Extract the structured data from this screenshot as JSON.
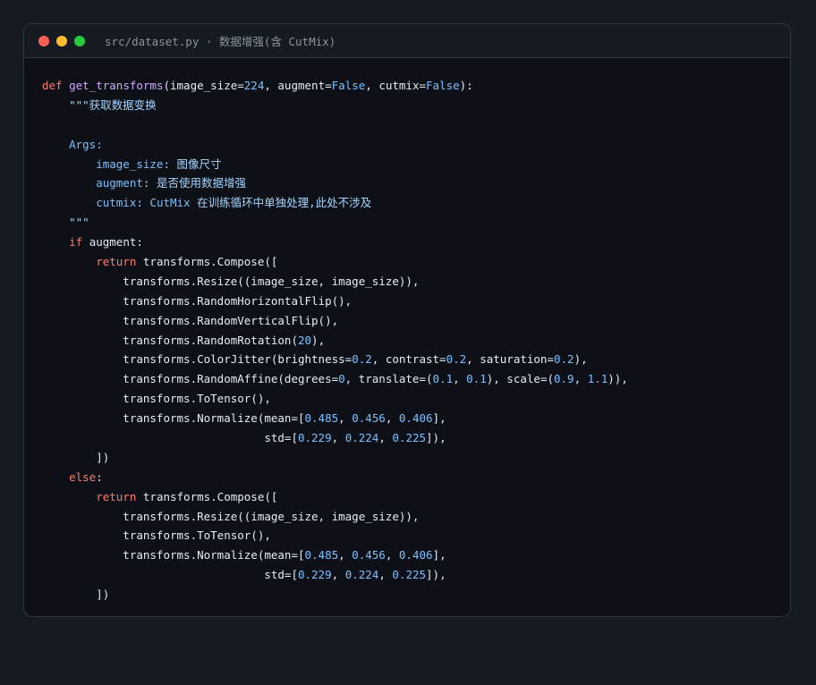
{
  "window": {
    "title": "src/dataset.py · 数据增强(含 CutMix)",
    "traffic_lights": [
      {
        "name": "close",
        "color": "#ff5f56"
      },
      {
        "name": "minimize",
        "color": "#ffbd2e"
      },
      {
        "name": "maximize",
        "color": "#27c93f"
      }
    ]
  },
  "colors": {
    "background": "#161b22",
    "editor": "#0d1117",
    "keyword": "#ff7b72",
    "function": "#d2a8ff",
    "number": "#79c0ff",
    "docstring": "#a5d6ff",
    "text": "#e6edf3"
  },
  "code_lines": [
    [
      [
        "kw",
        "def "
      ],
      [
        "fn",
        "get_transforms"
      ],
      [
        "p",
        "(image_size="
      ],
      [
        "num",
        "224"
      ],
      [
        "p",
        ", augment="
      ],
      [
        "cn",
        "False"
      ],
      [
        "p",
        ", cutmix="
      ],
      [
        "cn",
        "False"
      ],
      [
        "p",
        "):"
      ]
    ],
    [
      [
        "doc",
        "    \"\"\"获取数据变换"
      ]
    ],
    [
      [
        "p",
        ""
      ]
    ],
    [
      [
        "docfield",
        "    Args:"
      ]
    ],
    [
      [
        "docfield",
        "        image_size"
      ],
      [
        "doc",
        ": 图像尺寸"
      ]
    ],
    [
      [
        "docfield",
        "        augment"
      ],
      [
        "doc",
        ": 是否使用数据增强"
      ]
    ],
    [
      [
        "docfield",
        "        cutmix"
      ],
      [
        "doc",
        ": "
      ],
      [
        "docfield",
        "CutMix"
      ],
      [
        "doc",
        " 在训练循环中单独处理,此处不涉及"
      ]
    ],
    [
      [
        "doc",
        "    \"\"\""
      ]
    ],
    [
      [
        "kw",
        "    if "
      ],
      [
        "p",
        "augment:"
      ]
    ],
    [
      [
        "kw",
        "        return "
      ],
      [
        "p",
        "transforms.Compose(["
      ]
    ],
    [
      [
        "p",
        "            transforms.Resize((image_size, image_size)),"
      ]
    ],
    [
      [
        "p",
        "            transforms.RandomHorizontalFlip(),"
      ]
    ],
    [
      [
        "p",
        "            transforms.RandomVerticalFlip(),"
      ]
    ],
    [
      [
        "p",
        "            transforms.RandomRotation("
      ],
      [
        "num",
        "20"
      ],
      [
        "p",
        "),"
      ]
    ],
    [
      [
        "p",
        "            transforms.ColorJitter(brightness="
      ],
      [
        "num",
        "0.2"
      ],
      [
        "p",
        ", contrast="
      ],
      [
        "num",
        "0.2"
      ],
      [
        "p",
        ", saturation="
      ],
      [
        "num",
        "0.2"
      ],
      [
        "p",
        "),"
      ]
    ],
    [
      [
        "p",
        "            transforms.RandomAffine(degrees="
      ],
      [
        "num",
        "0"
      ],
      [
        "p",
        ", translate=("
      ],
      [
        "num",
        "0.1"
      ],
      [
        "p",
        ", "
      ],
      [
        "num",
        "0.1"
      ],
      [
        "p",
        "), scale=("
      ],
      [
        "num",
        "0.9"
      ],
      [
        "p",
        ", "
      ],
      [
        "num",
        "1.1"
      ],
      [
        "p",
        ")),"
      ]
    ],
    [
      [
        "p",
        "            transforms.ToTensor(),"
      ]
    ],
    [
      [
        "p",
        "            transforms.Normalize(mean=["
      ],
      [
        "num",
        "0.485"
      ],
      [
        "p",
        ", "
      ],
      [
        "num",
        "0.456"
      ],
      [
        "p",
        ", "
      ],
      [
        "num",
        "0.406"
      ],
      [
        "p",
        "],"
      ]
    ],
    [
      [
        "p",
        "                                 std=["
      ],
      [
        "num",
        "0.229"
      ],
      [
        "p",
        ", "
      ],
      [
        "num",
        "0.224"
      ],
      [
        "p",
        ", "
      ],
      [
        "num",
        "0.225"
      ],
      [
        "p",
        "]),"
      ]
    ],
    [
      [
        "p",
        "        ])"
      ]
    ],
    [
      [
        "kw",
        "    else"
      ],
      [
        "p",
        ":"
      ]
    ],
    [
      [
        "kw",
        "        return "
      ],
      [
        "p",
        "transforms.Compose(["
      ]
    ],
    [
      [
        "p",
        "            transforms.Resize((image_size, image_size)),"
      ]
    ],
    [
      [
        "p",
        "            transforms.ToTensor(),"
      ]
    ],
    [
      [
        "p",
        "            transforms.Normalize(mean=["
      ],
      [
        "num",
        "0.485"
      ],
      [
        "p",
        ", "
      ],
      [
        "num",
        "0.456"
      ],
      [
        "p",
        ", "
      ],
      [
        "num",
        "0.406"
      ],
      [
        "p",
        "],"
      ]
    ],
    [
      [
        "p",
        "                                 std=["
      ],
      [
        "num",
        "0.229"
      ],
      [
        "p",
        ", "
      ],
      [
        "num",
        "0.224"
      ],
      [
        "p",
        ", "
      ],
      [
        "num",
        "0.225"
      ],
      [
        "p",
        "]),"
      ]
    ],
    [
      [
        "p",
        "        ])"
      ]
    ]
  ]
}
